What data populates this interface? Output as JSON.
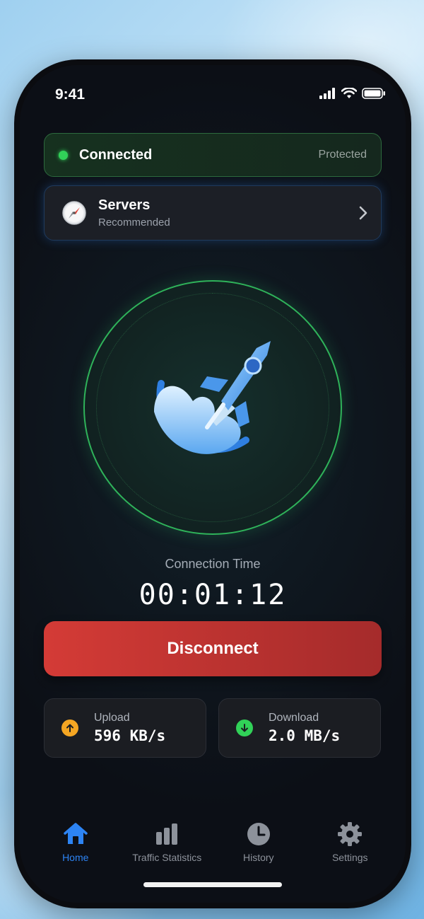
{
  "status_bar": {
    "time": "9:41",
    "icons": [
      "signal-icon",
      "wifi-icon",
      "battery-icon"
    ]
  },
  "connection": {
    "label": "Connected",
    "badge": "Protected",
    "status_color": "#31d158"
  },
  "servers": {
    "title": "Servers",
    "subtitle": "Recommended",
    "icon": "compass-icon"
  },
  "hero": {
    "icon": "rocket-icon",
    "ring_color": "#2fb35a"
  },
  "timer": {
    "label": "Connection Time",
    "value": "00:01:12"
  },
  "disconnect": {
    "label": "Disconnect",
    "color": "#d43b36"
  },
  "stats": {
    "upload": {
      "title": "Upload",
      "value": "596 KB/s",
      "color": "#f5a623"
    },
    "download": {
      "title": "Download",
      "value": "2.0 MB/s",
      "color": "#31d158"
    }
  },
  "tabs": [
    {
      "label": "Home",
      "icon": "home-icon",
      "active": true
    },
    {
      "label": "Traffic Statistics",
      "icon": "bar-chart-icon",
      "active": false
    },
    {
      "label": "History",
      "icon": "clock-icon",
      "active": false
    },
    {
      "label": "Settings",
      "icon": "gear-icon",
      "active": false
    }
  ],
  "accent": "#2d84f4"
}
